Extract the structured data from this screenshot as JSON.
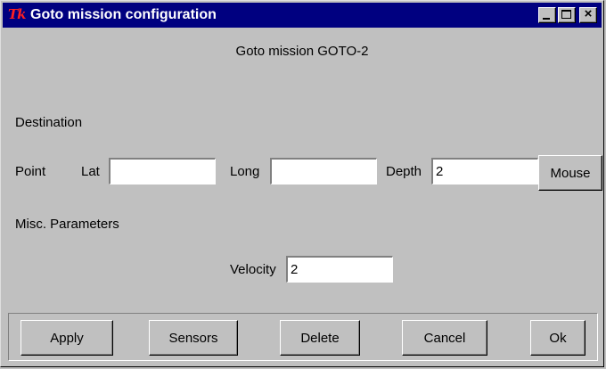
{
  "window": {
    "title": "Goto mission configuration",
    "logo_text": "Tk",
    "controls": {
      "minimize_icon": "minimize-icon",
      "maximize_icon": "maximize-icon",
      "close_icon": "close-icon",
      "close_glyph": "×"
    }
  },
  "header": {
    "mission_title": "Goto mission GOTO-2"
  },
  "destination": {
    "section_label": "Destination",
    "point_label": "Point",
    "lat_label": "Lat",
    "lat_value": "",
    "long_label": "Long",
    "long_value": "",
    "depth_label": "Depth",
    "depth_value": "2",
    "mouse_button": "Mouse"
  },
  "misc": {
    "section_label": "Misc. Parameters",
    "velocity_label": "Velocity",
    "velocity_value": "2"
  },
  "buttons": {
    "apply": "Apply",
    "sensors": "Sensors",
    "delete": "Delete",
    "cancel": "Cancel",
    "ok": "Ok"
  },
  "colors": {
    "titlebar": "#000080",
    "background": "#c0c0c0",
    "logo": "#ff2020"
  }
}
